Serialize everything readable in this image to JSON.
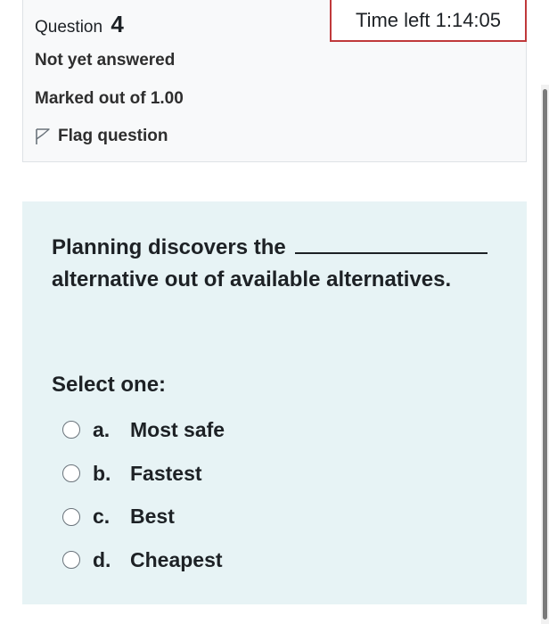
{
  "question": {
    "label": "Question",
    "number": "4",
    "state": "Not yet answered",
    "grade": "Marked out of 1.00",
    "flag_label": "Flag question"
  },
  "timer": {
    "text": "Time left 1:14:05"
  },
  "content": {
    "text_before": "Planning discovers the",
    "text_after": "alternative out of available alternatives.",
    "prompt": "Select one:",
    "answers": [
      {
        "letter": "a.",
        "text": "Most safe"
      },
      {
        "letter": "b.",
        "text": "Fastest"
      },
      {
        "letter": "c.",
        "text": "Best"
      },
      {
        "letter": "d.",
        "text": "Cheapest"
      }
    ]
  },
  "colors": {
    "content_background": "#e7f3f5",
    "info_background": "#f8f9fa",
    "timer_border": "#c0393b"
  },
  "icons": {
    "flag": "flag-outline-icon"
  }
}
